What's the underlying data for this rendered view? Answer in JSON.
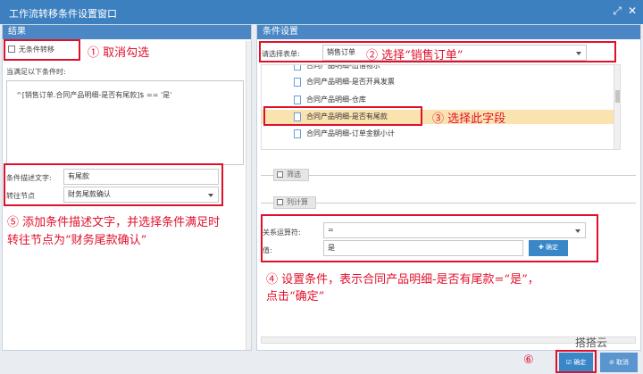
{
  "window": {
    "title": "工作流转移条件设置窗口"
  },
  "left_panel": {
    "header": "结果",
    "no_condition_checkbox": "无条件转移",
    "satisfy_label": "当满足以下条件时:",
    "condition_expression": "^[销售订单.合同产品明细-是否有尾款]$ == '是'",
    "desc_label": "条件描述文字:",
    "desc_value": "有尾款",
    "goto_label": "转往节点",
    "goto_value": "财务尾款确认"
  },
  "right_panel": {
    "header": "条件设置",
    "table_label": "请选择表单:",
    "table_value": "销售订单",
    "tree_items": [
      "合同产品明细-出借物示",
      "合同产品明细-是否开具发票",
      "合同产品明细-仓库",
      "合同产品明细-是否有尾款",
      "合同产品明细-订单金额小计"
    ],
    "filter_label": "筛选",
    "calc_label": "列计算",
    "operator_label": "关系运算符:",
    "operator_value": "=",
    "value_label": "值:",
    "value_value": "是",
    "confirm_label": "确定"
  },
  "footer": {
    "ok_label": "确定",
    "cancel_label": "取消",
    "watermark": "搭搭云"
  },
  "annotations": {
    "a1": "① 取消勾选",
    "a2": "② 选择“销售订单”",
    "a3": "③ 选择此字段",
    "a4_line1": "④ 设置条件，表示合同产品明细-是否有尾款=“是”，",
    "a4_line2": "点击“确定”",
    "a5_line1": "⑤ 添加条件描述文字，并选择条件满足时",
    "a5_line2": "转往节点为“财务尾款确认”",
    "a6": "⑥"
  },
  "colors": {
    "titlebar": "#3c80c0",
    "panel_header": "#4a87c4",
    "annotation_red": "#e0102b",
    "selected_row": "#fbe3b0",
    "ok_button": "#3a87c8",
    "cancel_button": "#5a95d0"
  },
  "icons": {
    "resize": "resize-icon",
    "close": "close-icon",
    "doc": "document-icon",
    "plus": "plus-icon",
    "check": "check-icon",
    "cancel": "cancel-icon"
  }
}
